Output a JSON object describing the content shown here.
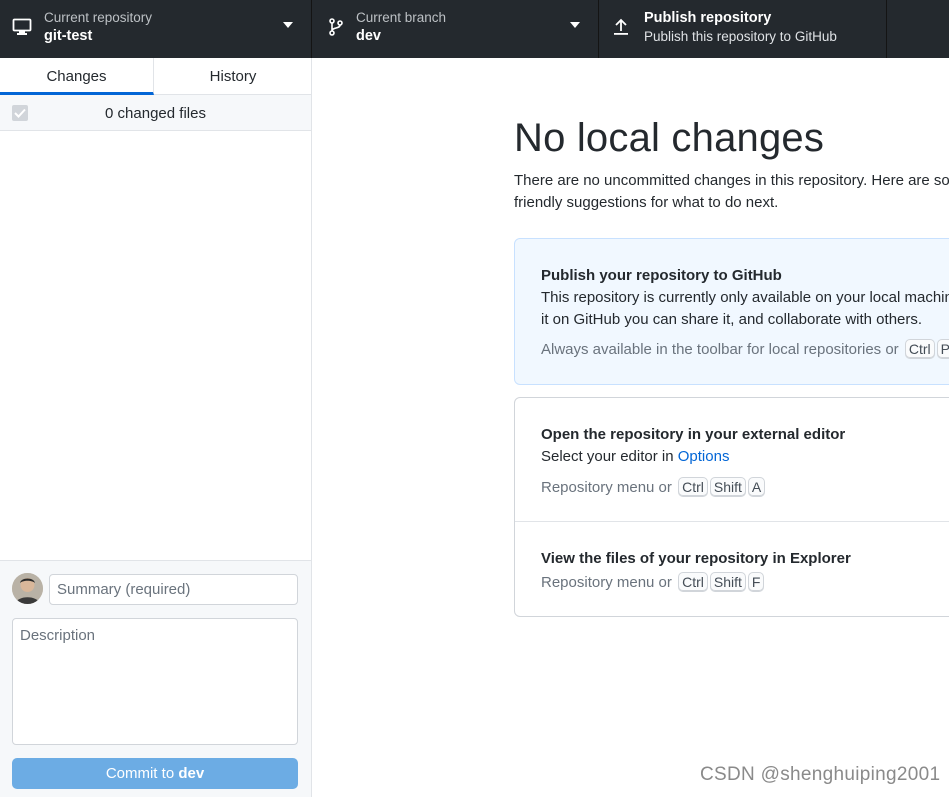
{
  "toolbar": {
    "repository": {
      "label": "Current repository",
      "value": "git-test",
      "icon": "desktop-icon"
    },
    "branch": {
      "label": "Current branch",
      "value": "dev",
      "icon": "git-branch-icon"
    },
    "publish": {
      "label": "Publish repository",
      "value": "Publish this repository to GitHub",
      "icon": "upload-arrow-icon"
    }
  },
  "sidebar": {
    "tabs": [
      {
        "label": "Changes",
        "selected": true
      },
      {
        "label": "History",
        "selected": false
      }
    ],
    "files_count": "0 changed files",
    "commit": {
      "summary_placeholder": "Summary (required)",
      "description_placeholder": "Description",
      "button_prefix": "Commit to",
      "button_branch": "dev"
    }
  },
  "main": {
    "title": "No local changes",
    "description": "There are no uncommitted changes in this repository. Here are some friendly suggestions for what to do next.",
    "publish_card": {
      "title": "Publish your repository to GitHub",
      "text_line1": "This repository is currently only available on your local machine. By publishing",
      "text_line2": "it on GitHub you can share it, and collaborate with others.",
      "hint": "Always available in the toolbar for local repositories or",
      "keys": [
        "Ctrl",
        "P"
      ]
    },
    "editor_card": {
      "title": "Open the repository in your external editor",
      "text_prefix": "Select your editor in",
      "link": "Options",
      "hint": "Repository menu or",
      "keys": [
        "Ctrl",
        "Shift",
        "A"
      ]
    },
    "explorer_card": {
      "title": "View the files of your repository in Explorer",
      "hint": "Repository menu or",
      "keys": [
        "Ctrl",
        "Shift",
        "F"
      ]
    }
  },
  "watermark": "CSDN @shenghuiping2001",
  "colors": {
    "toolbar_bg": "#24292e",
    "accent": "#0366d6",
    "commit_button": "#6cace4",
    "publish_card_bg": "#f1f8ff"
  }
}
